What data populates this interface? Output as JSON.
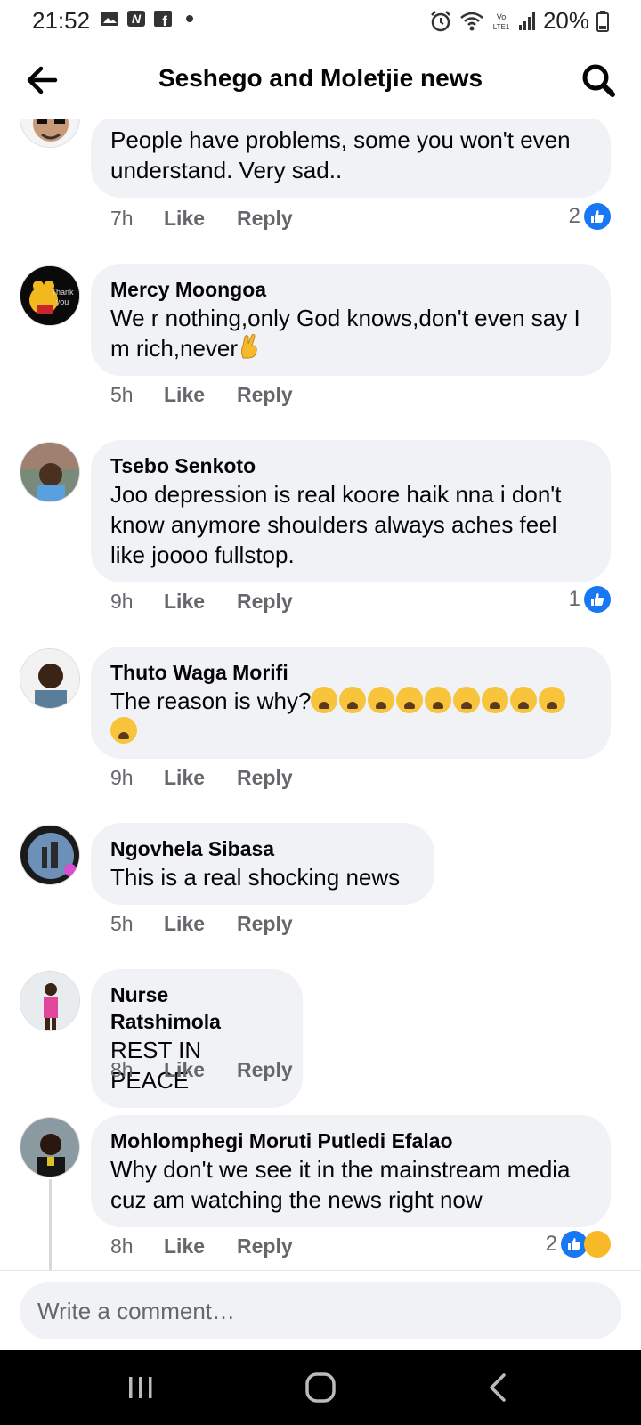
{
  "status_bar": {
    "time": "21:52",
    "battery": "20%",
    "left_icons": [
      "gallery-icon",
      "n-app-icon",
      "facebook-icon",
      "dot-icon"
    ],
    "right_icons": [
      "alarm-icon",
      "wifi-icon",
      "volte-icon",
      "signal-icon",
      "battery-icon"
    ],
    "network_label": "Vo LTE1"
  },
  "header": {
    "title": "Seshego and Moletjie news"
  },
  "comments": [
    {
      "author": "",
      "text": "People have problems, some you won't even understand. Very sad..",
      "time": "7h",
      "like_label": "Like",
      "reply_label": "Reply",
      "reaction_count": "2",
      "reactions": [
        "like"
      ]
    },
    {
      "author": "Mercy Moongoa",
      "text": "We r nothing,only God knows,don't even say I m rich,never",
      "time": "5h",
      "like_label": "Like",
      "reply_label": "Reply",
      "avatar_text": "Thank you"
    },
    {
      "author": "Tsebo Senkoto",
      "text": "Joo depression is real koore haik nna i don't know anymore shoulders always aches feel like joooo fullstop.",
      "time": "9h",
      "like_label": "Like",
      "reply_label": "Reply",
      "reaction_count": "1",
      "reactions": [
        "like"
      ]
    },
    {
      "author": "Thuto Waga Morifi",
      "text": "The reason is why?",
      "emoji_count": 10,
      "time": "9h",
      "like_label": "Like",
      "reply_label": "Reply"
    },
    {
      "author": "Ngovhela Sibasa",
      "text": "This is a real shocking news",
      "time": "5h",
      "like_label": "Like",
      "reply_label": "Reply"
    },
    {
      "author": "Nurse Ratshimola",
      "text": "REST IN PEACE",
      "time": "8h",
      "like_label": "Like",
      "reply_label": "Reply"
    },
    {
      "author": "Mohlomphegi Moruti Putledi Efalao",
      "text": "Why don't we see it in the mainstream media cuz am watching the news right now",
      "time": "8h",
      "like_label": "Like",
      "reply_label": "Reply",
      "reaction_count": "2",
      "reactions": [
        "like",
        "haha"
      ]
    }
  ],
  "composer": {
    "placeholder": "Write a comment…"
  },
  "colors": {
    "accent": "#1877f2",
    "bubble": "#f0f2f5",
    "meta": "#65676b"
  }
}
